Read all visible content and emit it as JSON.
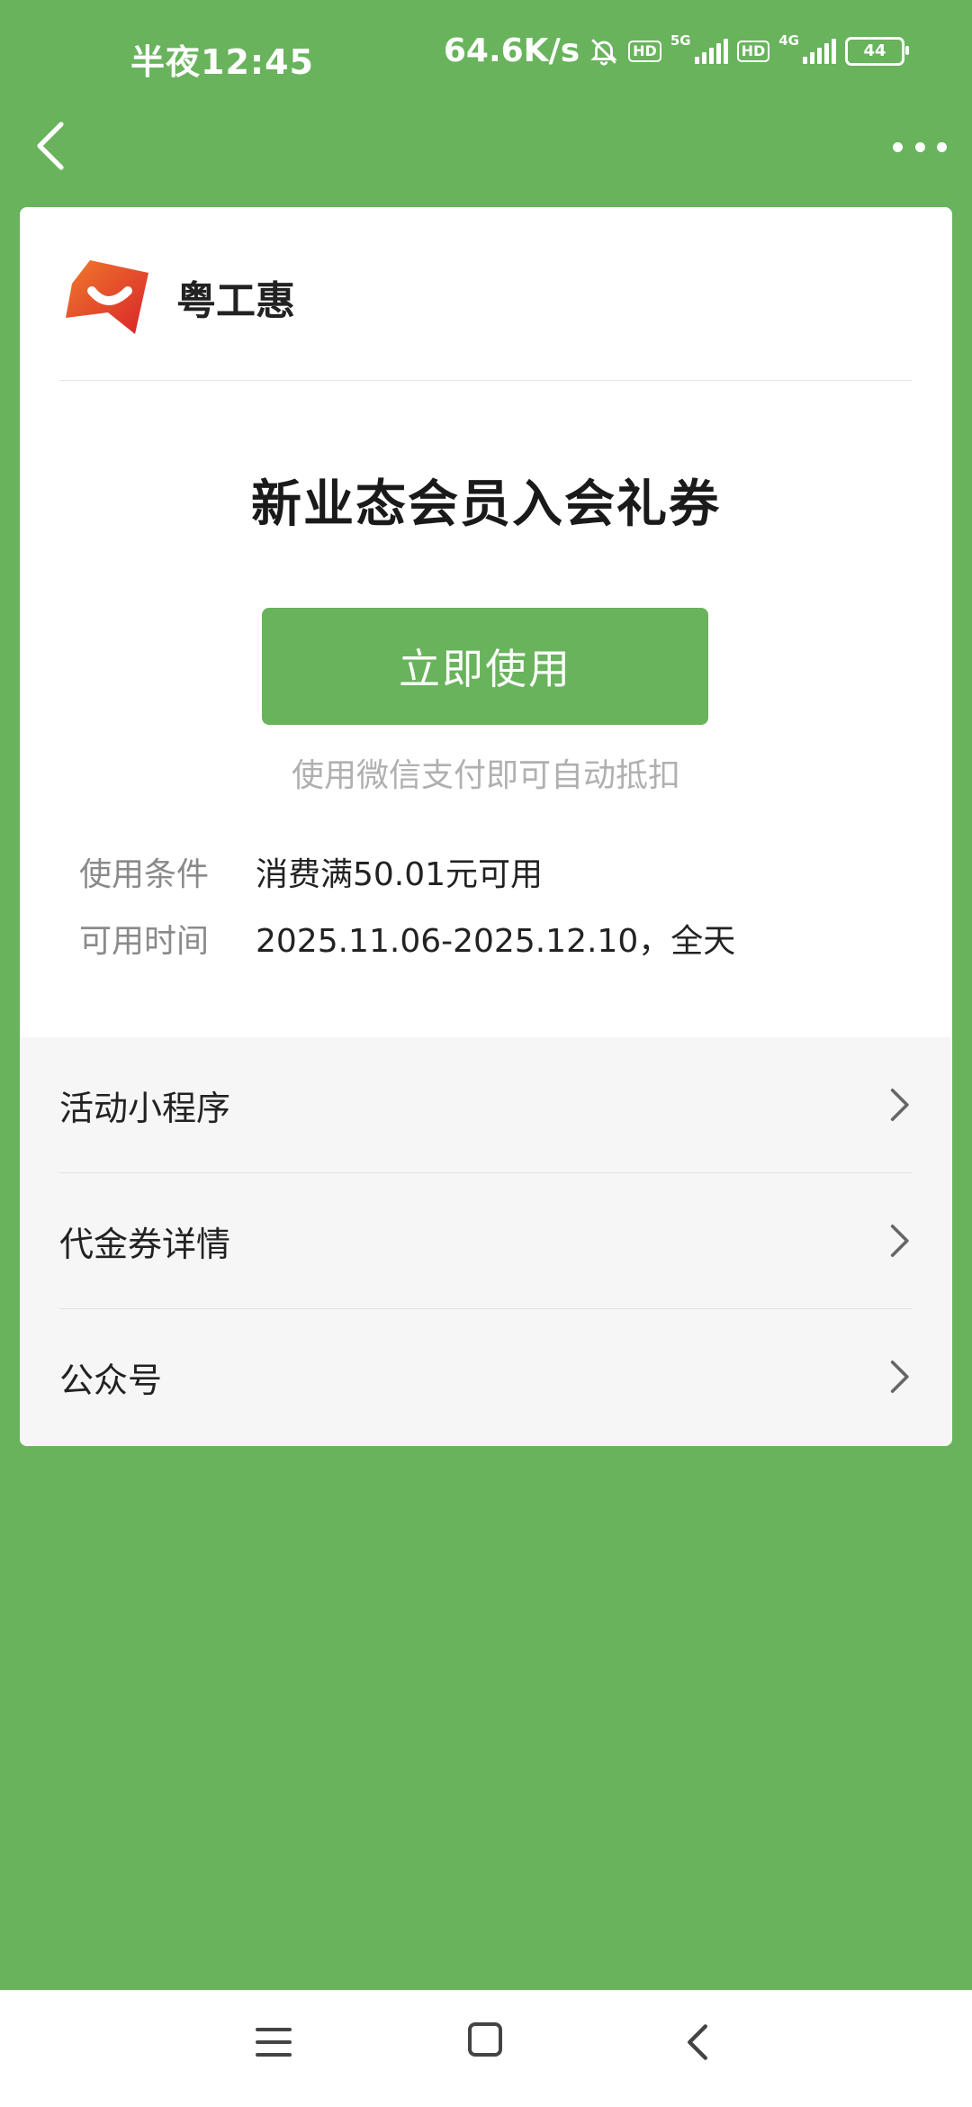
{
  "status_bar": {
    "time": "半夜12:45",
    "net_speed": "64.6K/s",
    "hd1": "HD",
    "net1": "5G",
    "hd2": "HD",
    "net2": "4G",
    "battery": "44"
  },
  "brand": {
    "name": "粤工惠",
    "logo_icon": "yuegonghui-logo-icon",
    "logo_color": "#e8432e"
  },
  "coupon": {
    "title": "新业态会员入会礼券",
    "button_label": "立即使用",
    "hint": "使用微信支付即可自动抵扣",
    "conditions_label": "使用条件",
    "conditions_value": "消费满50.01元可用",
    "time_label": "可用时间",
    "time_value": "2025.11.06-2025.12.10，全天"
  },
  "links": [
    {
      "label": "活动小程序"
    },
    {
      "label": "代金券详情"
    },
    {
      "label": "公众号"
    }
  ],
  "colors": {
    "accent": "#68b35c",
    "background": "#68b35c"
  }
}
